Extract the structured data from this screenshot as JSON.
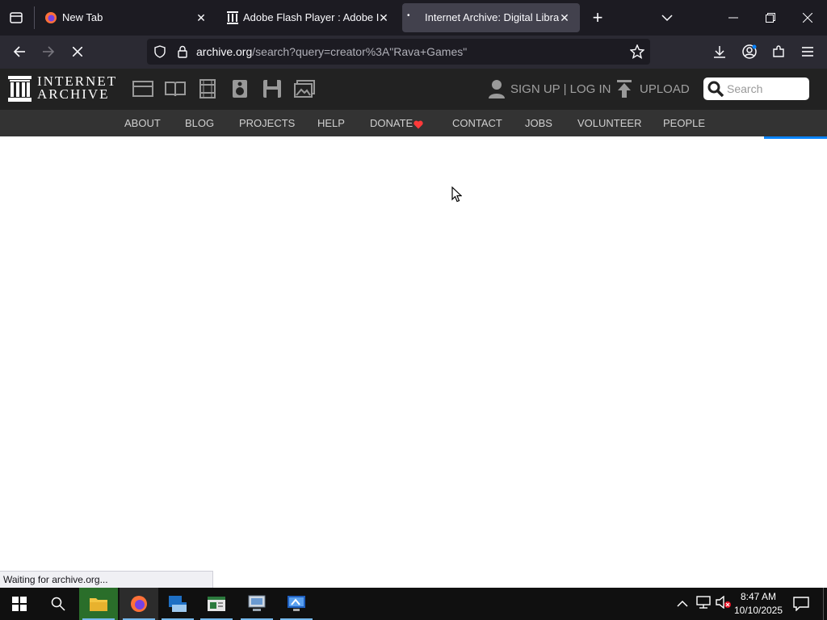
{
  "browser": {
    "tabs": [
      {
        "title": "New Tab",
        "active": false
      },
      {
        "title": "Adobe Flash Player : Adobe Inc.",
        "active": false
      },
      {
        "title": "Internet Archive: Digital Library",
        "active": true
      }
    ],
    "url_host": "archive.org",
    "url_rest": "/search?query=creator%3A\"Rava+Games\"",
    "status_text": "Waiting for archive.org..."
  },
  "ia_header": {
    "logo_line1": "INTERNET",
    "logo_line2": "ARCHIVE",
    "media_icons": [
      "web-icon",
      "texts-icon",
      "video-icon",
      "audio-icon",
      "software-icon",
      "images-icon"
    ],
    "account_text": "SIGN UP | LOG IN",
    "upload_text": "UPLOAD",
    "search_placeholder": "Search",
    "nav": [
      "ABOUT",
      "BLOG",
      "PROJECTS",
      "HELP",
      "DONATE",
      "CONTACT",
      "JOBS",
      "VOLUNTEER",
      "PEOPLE"
    ]
  },
  "taskbar": {
    "time": "8:47 AM",
    "date": "10/10/2025"
  },
  "colors": {
    "donate_heart": "#ff3a3a",
    "progress": "#0a84ff",
    "taskbar_accent": "#76b9ed"
  }
}
